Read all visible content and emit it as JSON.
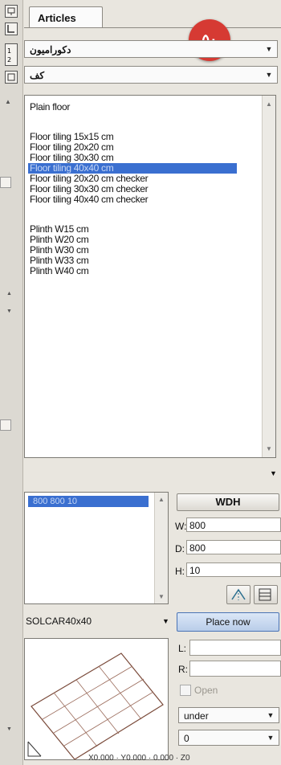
{
  "tab": {
    "label": "Articles"
  },
  "badge": {
    "text": "۵۰"
  },
  "combo1": {
    "value": "دکورامیون"
  },
  "combo2": {
    "value": "کف"
  },
  "list": {
    "items": [
      {
        "label": "Plain floor",
        "selected": false
      },
      {
        "label": "",
        "selected": false
      },
      {
        "label": "Floor tiling 15x15 cm",
        "selected": false
      },
      {
        "label": "Floor tiling 20x20 cm",
        "selected": false
      },
      {
        "label": "Floor tiling 30x30 cm",
        "selected": false
      },
      {
        "label": "Floor tiling 40x40 cm",
        "selected": true
      },
      {
        "label": "Floor tiling 20x20 cm checker",
        "selected": false
      },
      {
        "label": "Floor tiling 30x30 cm checker",
        "selected": false
      },
      {
        "label": "Floor tiling 40x40 cm checker",
        "selected": false
      },
      {
        "label": "",
        "selected": false
      },
      {
        "label": "Plinth W15 cm",
        "selected": false
      },
      {
        "label": "Plinth W20 cm",
        "selected": false
      },
      {
        "label": "Plinth W30 cm",
        "selected": false
      },
      {
        "label": "Plinth W33 cm",
        "selected": false
      },
      {
        "label": "Plinth W40 cm",
        "selected": false
      }
    ]
  },
  "sizes": {
    "selected": "800 800 10"
  },
  "dims": {
    "button": "WDH",
    "w_label": "W:",
    "w_value": "800",
    "d_label": "D:",
    "d_value": "800",
    "h_label": "H:",
    "h_value": "10"
  },
  "article": {
    "name": "SOLCAR40x40"
  },
  "place": {
    "label": "Place now"
  },
  "offsets": {
    "l_label": "L:",
    "r_label": "R:",
    "open_label": "Open",
    "position_value": "under",
    "angle_value": "0"
  },
  "footer": {
    "text": "X0.000 · Y0.000 · 0.000 · Z0"
  }
}
